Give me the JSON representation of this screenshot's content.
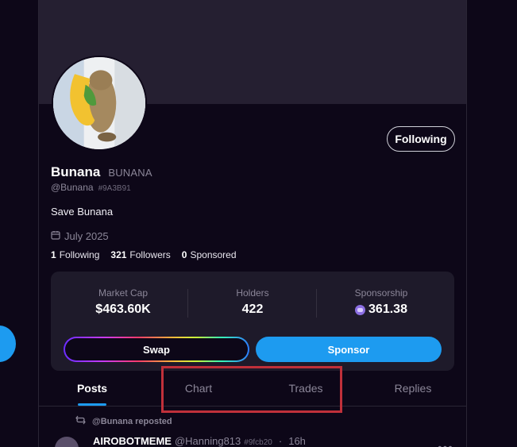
{
  "profile": {
    "display_name": "Bunana",
    "ticker": "BUNANA",
    "handle": "@Bunana",
    "hash_id": "#9A3B91",
    "bio": "Save Bunana",
    "joined": "July 2025",
    "follow_button_label": "Following"
  },
  "stats": {
    "following_count": "1",
    "following_label": "Following",
    "followers_count": "321",
    "followers_label": "Followers",
    "sponsored_count": "0",
    "sponsored_label": "Sponsored"
  },
  "market": {
    "market_cap_label": "Market Cap",
    "market_cap_value": "$463.60K",
    "holders_label": "Holders",
    "holders_value": "422",
    "sponsorship_label": "Sponsorship",
    "sponsorship_value": "361.38",
    "sponsorship_icon": "sponsorship-coin-icon"
  },
  "actions": {
    "swap_label": "Swap",
    "sponsor_label": "Sponsor"
  },
  "tabs": [
    {
      "label": "Posts",
      "active": true
    },
    {
      "label": "Chart",
      "active": false
    },
    {
      "label": "Trades",
      "active": false
    },
    {
      "label": "Replies",
      "active": false
    }
  ],
  "feed": {
    "repost_label": "@Bunana reposted",
    "post": {
      "author_name": "AIROBOTMEME",
      "author_handle": "@Hanning813",
      "author_hash": "#9fcb20",
      "time": "16h"
    }
  },
  "colors": {
    "accent": "#1d9bf0",
    "background": "#0d0718",
    "banner": "#251f31",
    "card": "#1e1a2a",
    "highlight": "#c0303a"
  }
}
